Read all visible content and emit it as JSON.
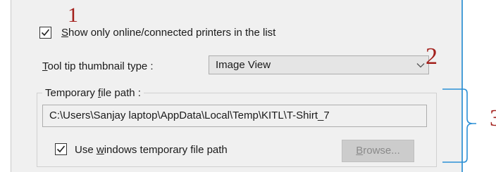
{
  "annotations": {
    "one": "1",
    "two": "2",
    "three": "3"
  },
  "settings": {
    "show_online_printers": {
      "checked": true,
      "mnemonic": "S",
      "label_rest": "how only online/connected printers in the list"
    },
    "tooltip_thumbnail": {
      "mnemonic": "T",
      "label_rest": "ool tip thumbnail type :",
      "selected_value": "Image View"
    },
    "temp_file_group": {
      "title_prefix": "Temporary ",
      "title_mnemonic": "f",
      "title_suffix": "ile path :",
      "path_value": "C:\\Users\\Sanjay laptop\\AppData\\Local\\Temp\\KITL\\T-Shirt_7",
      "use_windows_temp": {
        "checked": true,
        "label_prefix": "Use ",
        "mnemonic": "w",
        "label_suffix": "indows temporary file path"
      },
      "browse_button": {
        "mnemonic": "B",
        "label_rest": "rowse..."
      }
    }
  },
  "colors": {
    "annotation": "#a3201c",
    "bracket": "#2b8fd6",
    "panel_background": "#f0f0f0"
  }
}
